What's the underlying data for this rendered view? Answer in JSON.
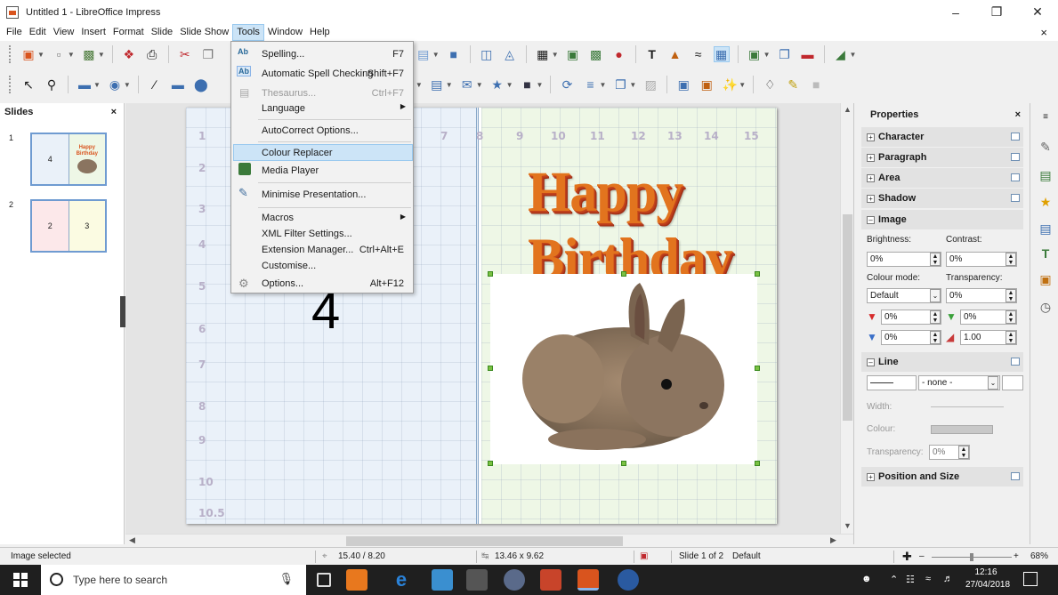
{
  "window": {
    "title": "Untitled 1 - LibreOffice Impress",
    "minimize": "–",
    "maximize": "❐",
    "close": "✕"
  },
  "menu": {
    "items": [
      "File",
      "Edit",
      "View",
      "Insert",
      "Format",
      "Slide",
      "Slide Show",
      "Tools",
      "Window",
      "Help"
    ],
    "active": "Tools",
    "doc_close": "×"
  },
  "tools_menu": [
    {
      "label": "Spelling...",
      "shortcut": "F7",
      "icon": "spelling-icon",
      "enabled": true
    },
    {
      "label": "Automatic Spell Checking",
      "shortcut": "Shift+F7",
      "icon": "auto-spellcheck-icon",
      "enabled": true
    },
    {
      "label": "Thesaurus...",
      "shortcut": "Ctrl+F7",
      "icon": "thesaurus-icon",
      "enabled": false
    },
    {
      "label": "Language",
      "shortcut": "",
      "submenu": true,
      "enabled": true
    },
    {
      "label": "AutoCorrect Options...",
      "shortcut": "",
      "enabled": true
    },
    {
      "label": "Colour Replacer",
      "shortcut": "",
      "highlighted": true,
      "enabled": true
    },
    {
      "label": "Media Player",
      "shortcut": "",
      "icon": "media-player-icon",
      "enabled": true
    },
    {
      "label": "Minimise Presentation...",
      "shortcut": "",
      "icon": "minimise-presentation-icon",
      "enabled": true
    },
    {
      "label": "Macros",
      "shortcut": "",
      "submenu": true,
      "enabled": true
    },
    {
      "label": "XML Filter Settings...",
      "shortcut": "",
      "enabled": true
    },
    {
      "label": "Extension Manager...",
      "shortcut": "Ctrl+Alt+E",
      "enabled": true
    },
    {
      "label": "Customise...",
      "shortcut": "",
      "enabled": true
    },
    {
      "label": "Options...",
      "shortcut": "Alt+F12",
      "icon": "options-gear-icon",
      "enabled": true
    }
  ],
  "slides_pane": {
    "title": "Slides",
    "close": "×",
    "slides": [
      {
        "number": "1",
        "left_label": "4",
        "right_label": "Happy Birthday"
      },
      {
        "number": "2",
        "left_label": "2",
        "right_label": "3"
      }
    ]
  },
  "canvas": {
    "left_numbers": [
      "1",
      "2",
      "3",
      "4",
      "5",
      "6",
      "7",
      "8",
      "9",
      "10",
      "10.5"
    ],
    "top_numbers": [
      "7",
      "8",
      "9",
      "10",
      "11",
      "12",
      "13",
      "14",
      "15"
    ],
    "big_number": "4",
    "headline": "Happy Birthday"
  },
  "properties": {
    "title": "Properties",
    "close": "×",
    "panels": {
      "character": "Character",
      "paragraph": "Paragraph",
      "area": "Area",
      "shadow": "Shadow",
      "image": "Image",
      "line": "Line",
      "position_size": "Position and Size"
    },
    "image": {
      "brightness_label": "Brightness:",
      "brightness": "0%",
      "contrast_label": "Contrast:",
      "contrast": "0%",
      "colour_mode_label": "Colour mode:",
      "colour_mode": "Default",
      "transparency_label": "Transparency:",
      "transparency": "0%",
      "red": "0%",
      "green": "0%",
      "blue": "0%",
      "gamma": "1.00"
    },
    "line": {
      "style": "- none -",
      "width_label": "Width:",
      "colour_label": "Colour:",
      "transparency_label": "Transparency:",
      "transparency": "0%"
    }
  },
  "statusbar": {
    "selection": "Image selected",
    "position": "15.40 / 8.20",
    "size": "13.46 x 9.62",
    "slide": "Slide 1 of 2",
    "master": "Default",
    "zoom": "68%",
    "zoom_minus": "–",
    "zoom_plus": "+"
  },
  "taskbar": {
    "search_placeholder": "Type here to search",
    "time": "12:16",
    "date": "27/04/2018"
  },
  "colors": {
    "menu_highlight": "#cce4f7",
    "handle": "#7ac142",
    "accent_birthday": "#e2741e"
  }
}
